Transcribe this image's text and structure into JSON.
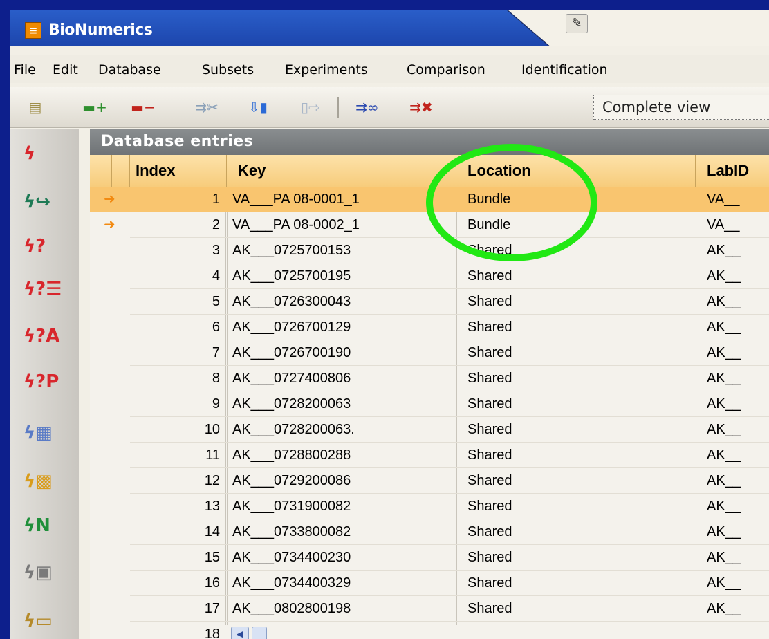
{
  "window": {
    "title": "BioNumerics"
  },
  "menu": [
    "File",
    "Edit",
    "Database",
    "Subsets",
    "Experiments",
    "Comparison",
    "Identification"
  ],
  "toolbar": {
    "view_select": "Complete view"
  },
  "panel": {
    "title": "Database entries",
    "columns": [
      "Index",
      "Key",
      "Location",
      "LabID"
    ],
    "rows": [
      {
        "index": "1",
        "key": "VA___PA 08-0001_1",
        "location": "Bundle",
        "labid": "VA__",
        "arrow": true
      },
      {
        "index": "2",
        "key": "VA___PA 08-0002_1",
        "location": "Bundle",
        "labid": "VA__",
        "arrow": true
      },
      {
        "index": "3",
        "key": "AK___0725700153",
        "location": "Shared",
        "labid": "AK__"
      },
      {
        "index": "4",
        "key": "AK___0725700195",
        "location": "Shared",
        "labid": "AK__"
      },
      {
        "index": "5",
        "key": "AK___0726300043",
        "location": "Shared",
        "labid": "AK__"
      },
      {
        "index": "6",
        "key": "AK___0726700129",
        "location": "Shared",
        "labid": "AK__"
      },
      {
        "index": "7",
        "key": "AK___0726700190",
        "location": "Shared",
        "labid": "AK__"
      },
      {
        "index": "8",
        "key": "AK___0727400806",
        "location": "Shared",
        "labid": "AK__"
      },
      {
        "index": "9",
        "key": "AK___0728200063",
        "location": "Shared",
        "labid": "AK__"
      },
      {
        "index": "10",
        "key": "AK___0728200063.",
        "location": "Shared",
        "labid": "AK__"
      },
      {
        "index": "11",
        "key": "AK___0728800288",
        "location": "Shared",
        "labid": "AK__"
      },
      {
        "index": "12",
        "key": "AK___0729200086",
        "location": "Shared",
        "labid": "AK__"
      },
      {
        "index": "13",
        "key": "AK___0731900082",
        "location": "Shared",
        "labid": "AK__"
      },
      {
        "index": "14",
        "key": "AK___0733800082",
        "location": "Shared",
        "labid": "AK__"
      },
      {
        "index": "15",
        "key": "AK___0734400230",
        "location": "Shared",
        "labid": "AK__"
      },
      {
        "index": "16",
        "key": "AK___0734400329",
        "location": "Shared",
        "labid": "AK__"
      },
      {
        "index": "17",
        "key": "AK___0802800198",
        "location": "Shared",
        "labid": "AK__"
      },
      {
        "index": "18",
        "key": "",
        "location": "",
        "labid": ""
      }
    ]
  },
  "colors": {
    "background": "#0d1f8c",
    "selection": "#f9c56f",
    "header": "#f7cc7c",
    "annotation": "#21e814"
  }
}
